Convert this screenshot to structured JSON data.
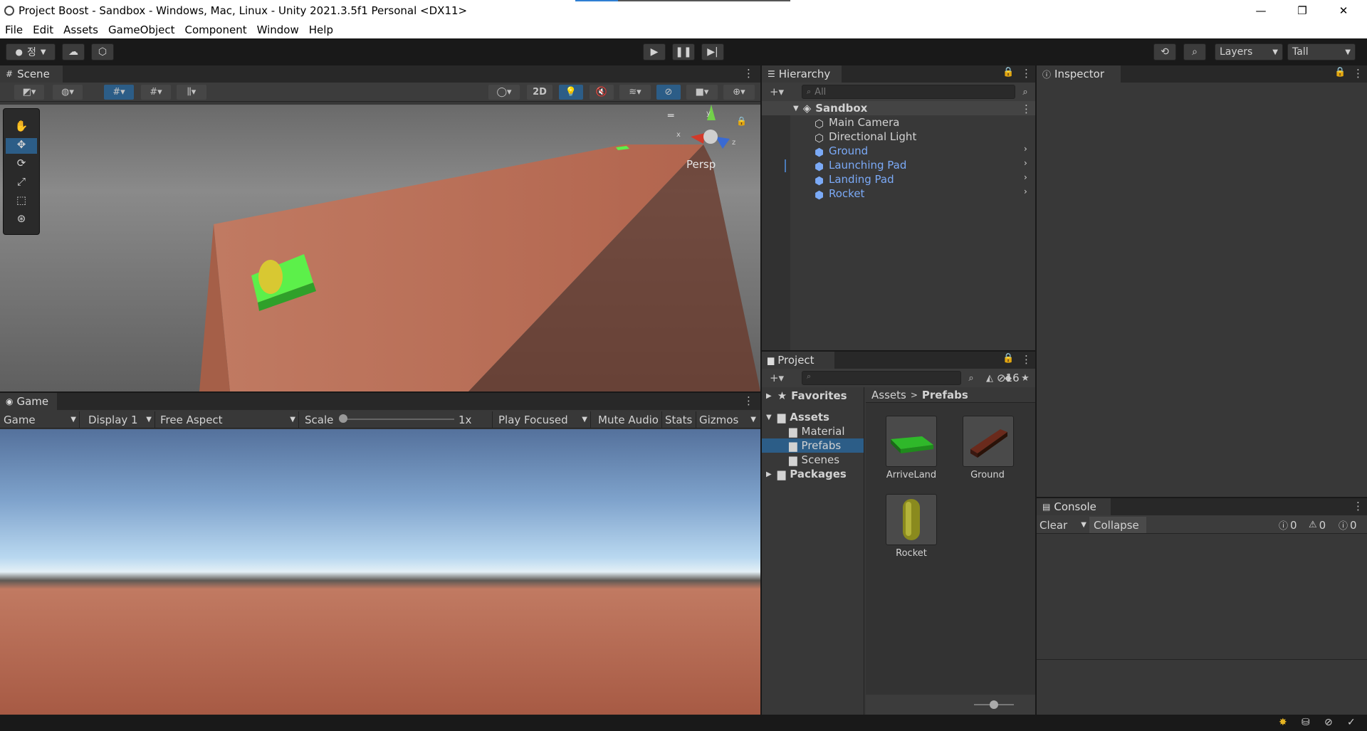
{
  "window": {
    "title": "Project Boost - Sandbox - Windows, Mac, Linux - Unity 2021.3.5f1 Personal <DX11>",
    "minimize": "—",
    "restore": "❐",
    "close": "✕"
  },
  "menu": [
    "File",
    "Edit",
    "Assets",
    "GameObject",
    "Component",
    "Window",
    "Help"
  ],
  "toolbar": {
    "account": "정",
    "layers": "Layers",
    "layout": "Tall"
  },
  "scene": {
    "tab": "Scene",
    "mode_2d": "2D",
    "persp": "Persp",
    "axis_x": "x",
    "axis_y": "y",
    "axis_z": "z"
  },
  "game": {
    "tab": "Game",
    "view": "Game",
    "display": "Display 1",
    "aspect": "Free Aspect",
    "scale_label": "Scale",
    "scale_value": "1x",
    "play_mode": "Play Focused",
    "mute": "Mute Audio",
    "stats": "Stats",
    "gizmos": "Gizmos"
  },
  "hierarchy": {
    "tab": "Hierarchy",
    "search_placeholder": "All",
    "scene": "Sandbox",
    "items": [
      "Main Camera",
      "Directional Light",
      "Ground",
      "Launching Pad",
      "Landing Pad",
      "Rocket"
    ]
  },
  "inspector": {
    "tab": "Inspector"
  },
  "project": {
    "tab": "Project",
    "count": "16",
    "favorites": "Favorites",
    "assets": "Assets",
    "folders": [
      "Material",
      "Prefabs",
      "Scenes"
    ],
    "packages": "Packages",
    "breadcrumb_root": "Assets",
    "breadcrumb_sep": ">",
    "breadcrumb_current": "Prefabs",
    "prefabs": [
      "ArriveLand",
      "Ground",
      "Rocket"
    ]
  },
  "console": {
    "tab": "Console",
    "clear": "Clear",
    "collapse": "Collapse",
    "logs": "0",
    "warnings": "0",
    "errors": "0"
  },
  "colors": {
    "accent": "#2c5d87",
    "selection": "#2c5d87",
    "prefab_blue": "#7baaf7"
  }
}
